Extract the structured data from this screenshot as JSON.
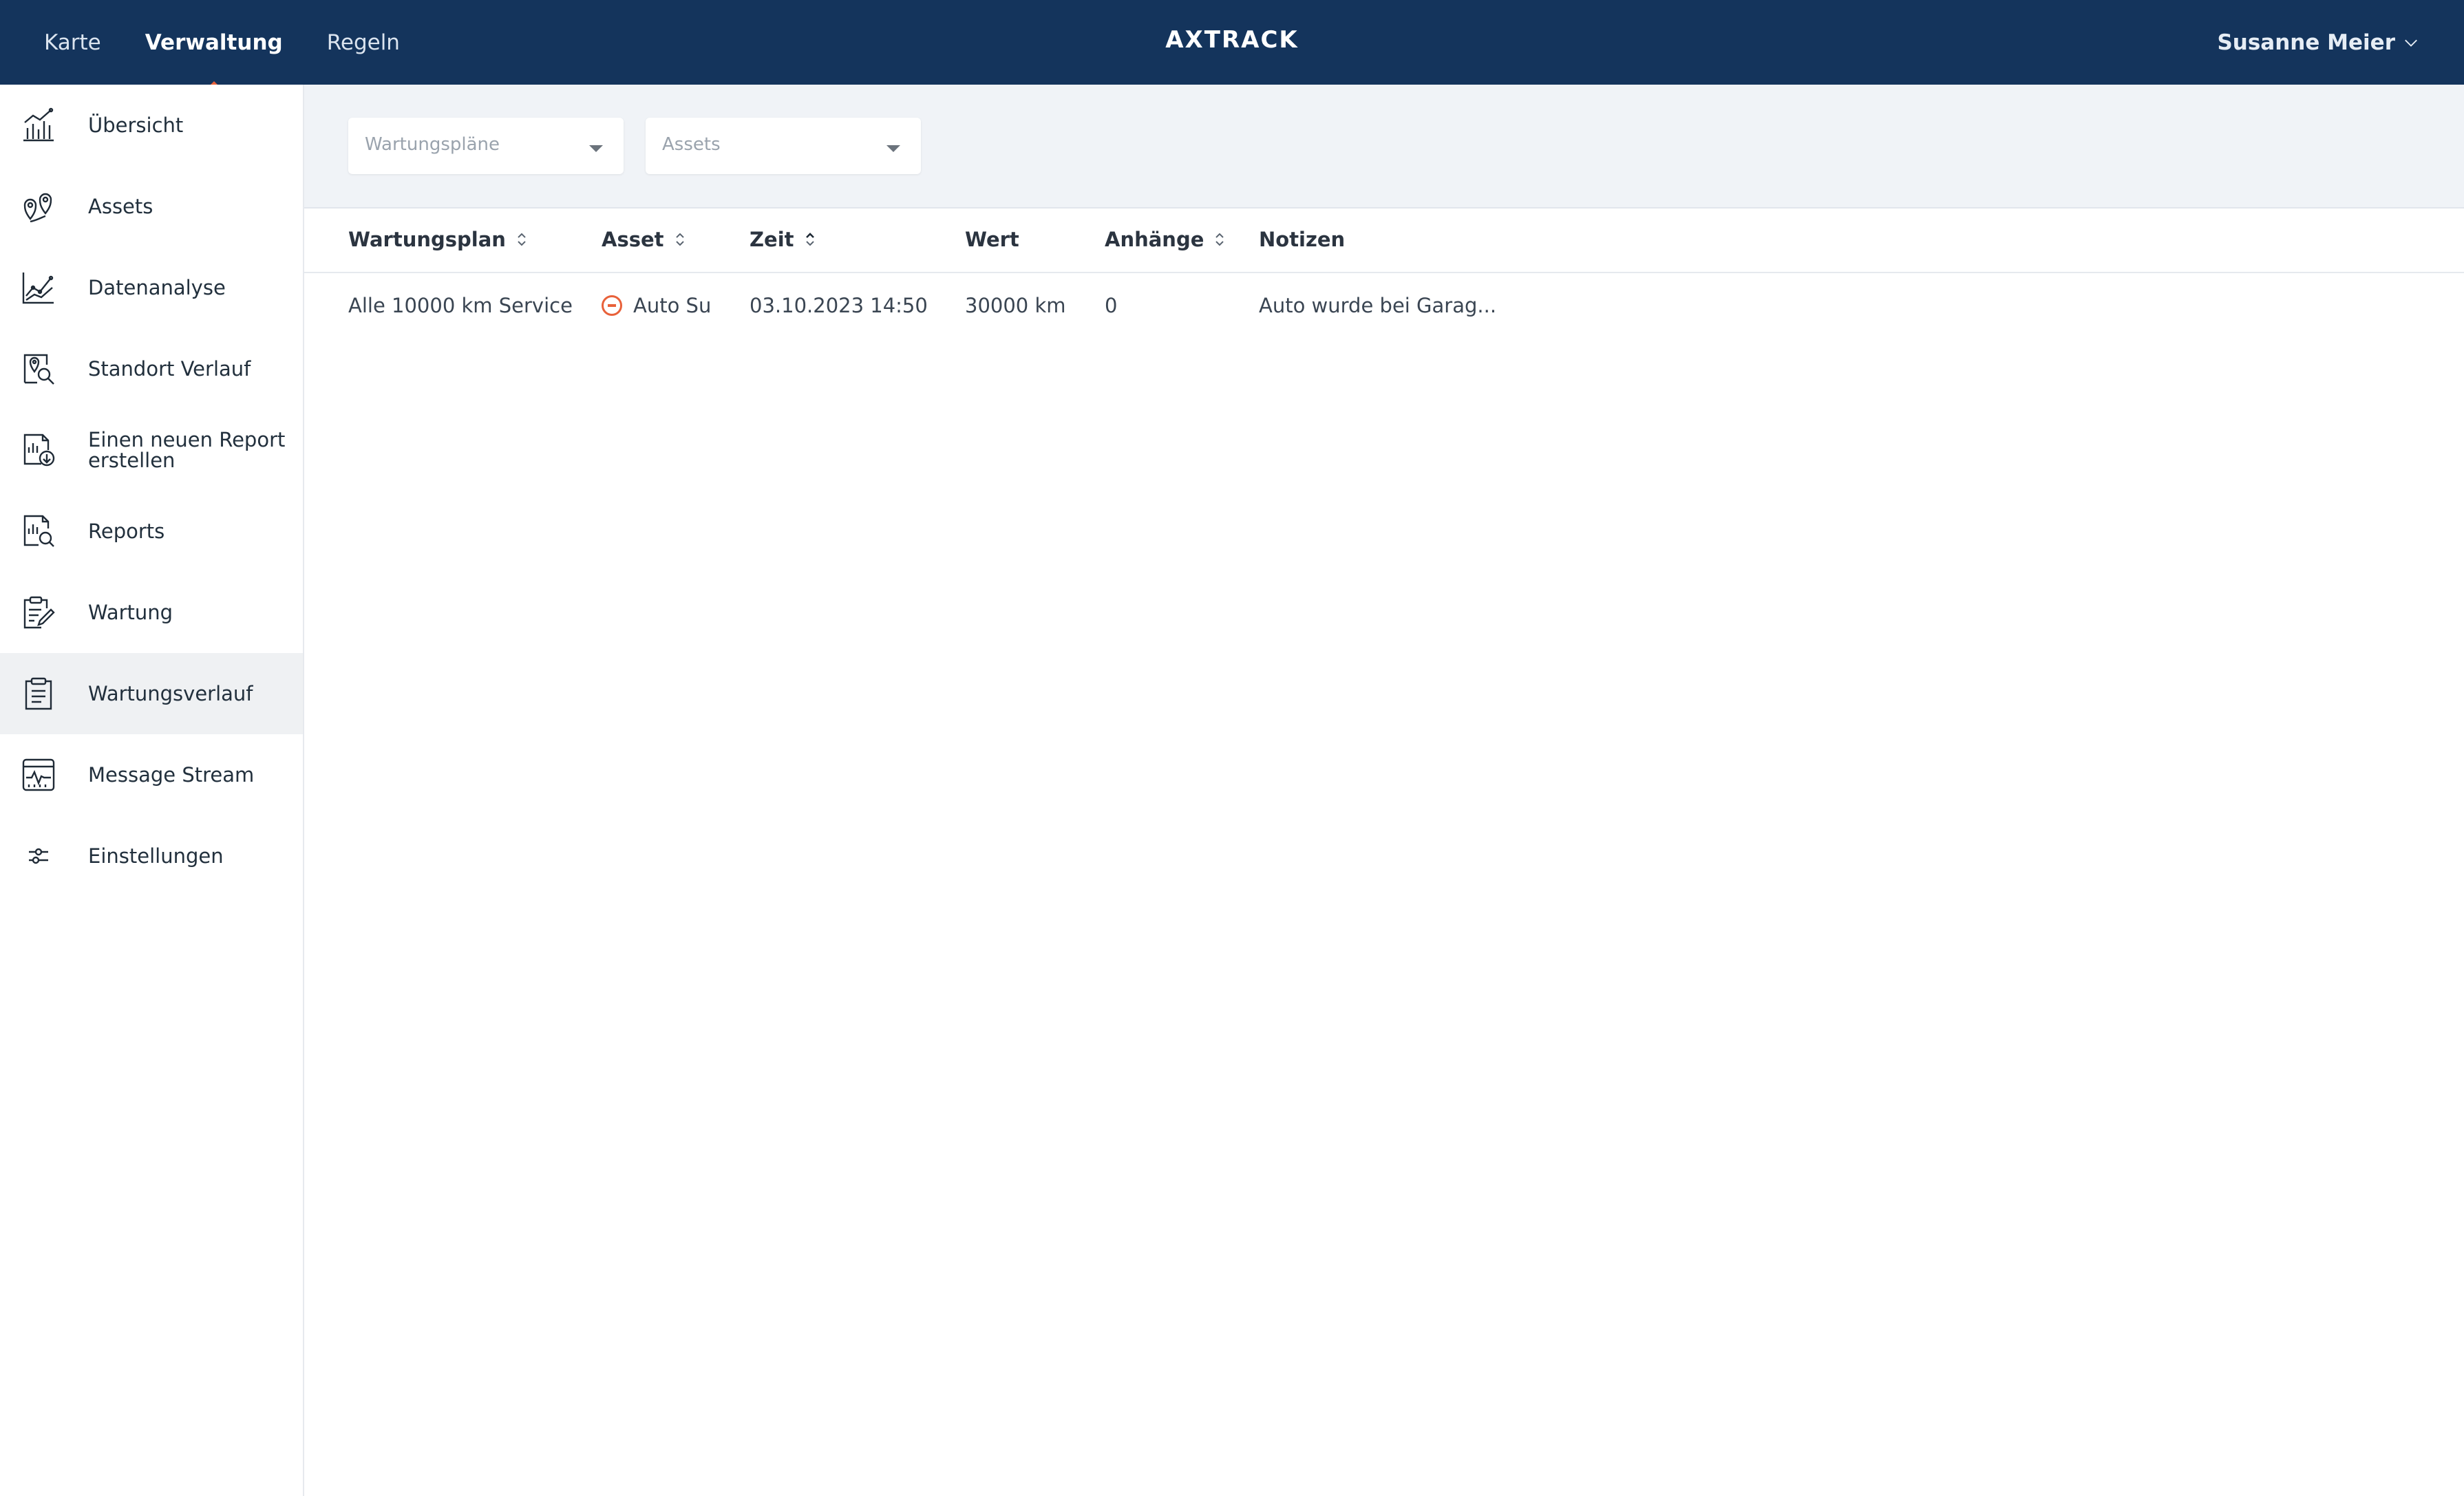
{
  "nav": {
    "items": [
      {
        "label": "Karte",
        "active": false
      },
      {
        "label": "Verwaltung",
        "active": true
      },
      {
        "label": "Regeln",
        "active": false
      }
    ]
  },
  "brand": {
    "prefix": "A",
    "mark": "X",
    "suffix": "TRACK"
  },
  "user": {
    "name": "Susanne Meier",
    "icon": "chevron-down-icon"
  },
  "sidebar": {
    "items": [
      {
        "label": "Übersicht",
        "icon": "bar-chart-icon"
      },
      {
        "label": "Assets",
        "icon": "map-pins-icon"
      },
      {
        "label": "Datenanalyse",
        "icon": "line-chart-icon"
      },
      {
        "label": "Standort Verlauf",
        "icon": "location-search-icon"
      },
      {
        "label": "Einen neuen Report erstellen",
        "icon": "report-download-icon"
      },
      {
        "label": "Reports",
        "icon": "report-search-icon"
      },
      {
        "label": "Wartung",
        "icon": "clipboard-edit-icon"
      },
      {
        "label": "Wartungsverlauf",
        "icon": "clipboard-list-icon",
        "active": true
      },
      {
        "label": "Message Stream",
        "icon": "monitor-wave-icon"
      },
      {
        "label": "Einstellungen",
        "icon": "sliders-icon"
      }
    ]
  },
  "filters": {
    "plans_placeholder": "Wartungspläne",
    "assets_placeholder": "Assets"
  },
  "table": {
    "columns": [
      "Wartungsplan",
      "Asset",
      "Zeit",
      "Wert",
      "Anhänge",
      "Notizen"
    ],
    "rows": [
      {
        "plan": "Alle 10000 km Service",
        "asset": "Auto Su",
        "time": "03.10.2023 14:50",
        "value": "30000 km",
        "attachments": "0",
        "notes": "Auto wurde bei Garag..."
      }
    ]
  },
  "colors": {
    "header_bg": "#14345c",
    "accent": "#e8613a",
    "active_row_bg": "#eff1f3",
    "filter_bg": "#f0f3f7"
  }
}
